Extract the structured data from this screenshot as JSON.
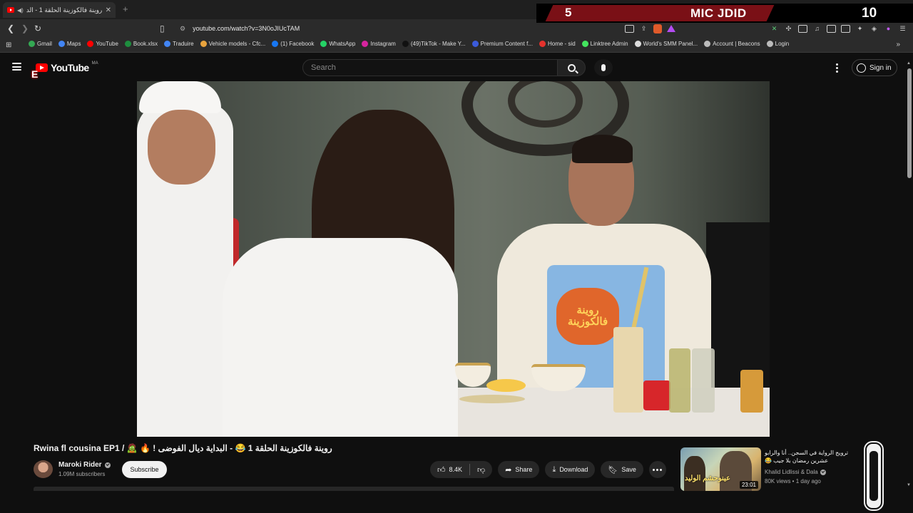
{
  "browser": {
    "tab_title": "روينة فالكوزينة الحلقة 1 - الد",
    "url": "youtube.com/watch?v=3N0oJIUcTAM",
    "bookmarks": [
      {
        "label": "Gmail",
        "color": "#34a853"
      },
      {
        "label": "Maps",
        "color": "#4285f4"
      },
      {
        "label": "YouTube",
        "color": "#ff0000"
      },
      {
        "label": "Book.xlsx",
        "color": "#1e8e3e"
      },
      {
        "label": "Traduire",
        "color": "#4285f4"
      },
      {
        "label": "Vehicle models - Cfc...",
        "color": "#e8a33d"
      },
      {
        "label": "(1) Facebook",
        "color": "#1877f2"
      },
      {
        "label": "WhatsApp",
        "color": "#25d366"
      },
      {
        "label": "Instagram",
        "color": "#d6249f"
      },
      {
        "label": "(49)TikTok - Make Y...",
        "color": "#111111"
      },
      {
        "label": "Premium Content f...",
        "color": "#3b5bdb"
      },
      {
        "label": "Home - sid",
        "color": "#e5322d"
      },
      {
        "label": "Linktree Admin",
        "color": "#43e55e"
      },
      {
        "label": "World's SMM Panel...",
        "color": "#dddddd"
      },
      {
        "label": "Account | Beacons",
        "color": "#bbbbbb"
      },
      {
        "label": "Login",
        "color": "#bbbbbb"
      }
    ]
  },
  "overlay": {
    "left_number": "5",
    "label": "MIC JDID",
    "right_number": "10"
  },
  "youtube": {
    "logo_text": "YouTube",
    "country_code": "MA",
    "search_placeholder": "Search",
    "sign_in": "Sign in"
  },
  "video": {
    "apron_text": "روينة فالكوزينة",
    "title": "Rwina fl cousina EP1 / 🧟 🔥 ! روينة فالكوزينة الحلقة 1 😂 - البداية ديال الفوضى",
    "channel_name": "Maroki Rider",
    "subscribers": "1.09M subscribers",
    "subscribe_label": "Subscribe",
    "likes": "8.4K",
    "share_label": "Share",
    "download_label": "Download",
    "save_label": "Save"
  },
  "recommendation": {
    "title": "ترويج الرواية في السجن.. أنا والرابو عشرين رمضان بلا جيب 😂",
    "thumb_text": "عينوحشم الوليد",
    "channel": "Khalid Lidlissi & Dala",
    "meta": "80K views • 1 day ago",
    "duration": "23:01"
  }
}
